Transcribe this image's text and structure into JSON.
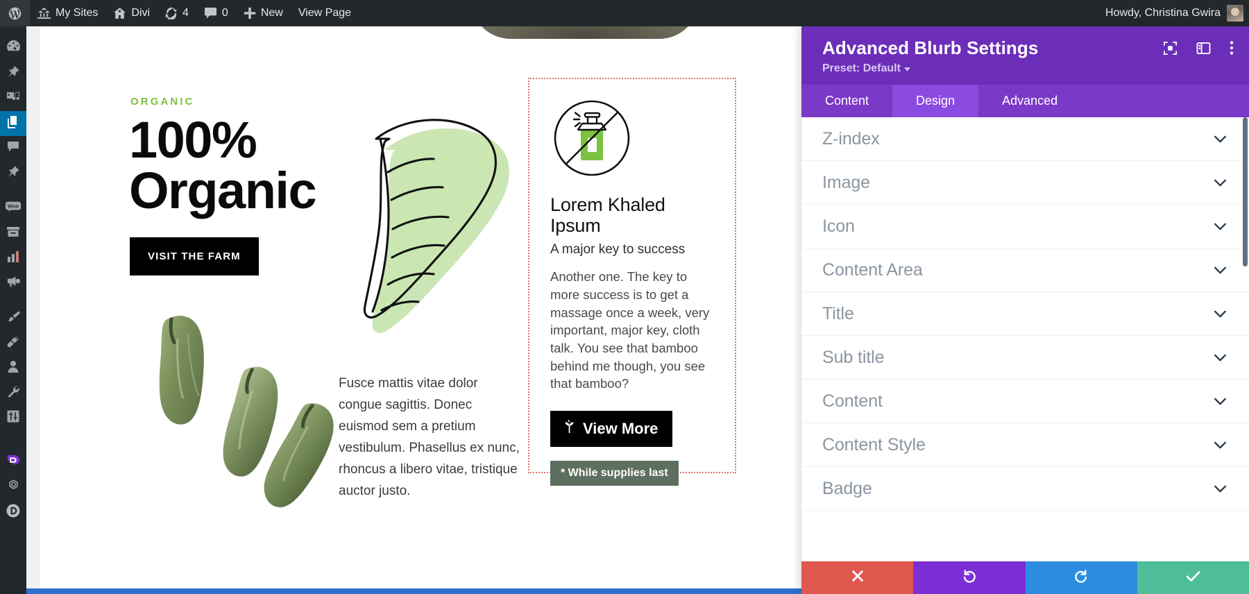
{
  "admin_bar": {
    "items": [
      {
        "id": "wp-logo",
        "icon": "wordpress-icon",
        "label": ""
      },
      {
        "id": "my-sites",
        "icon": "sites-icon",
        "label": "My Sites"
      },
      {
        "id": "site-name",
        "icon": "home-icon",
        "label": "Divi"
      },
      {
        "id": "updates",
        "icon": "updates-icon",
        "label": "4"
      },
      {
        "id": "comments",
        "icon": "comment-icon",
        "label": "0"
      },
      {
        "id": "new-content",
        "icon": "plus-icon",
        "label": "New"
      },
      {
        "id": "view-page",
        "icon": "",
        "label": "View Page"
      }
    ],
    "greeting": "Howdy, Christina Gwira"
  },
  "admin_menu": {
    "items": [
      {
        "name": "dashboard",
        "icon": "dashboard-icon",
        "active": false
      },
      {
        "name": "posts",
        "icon": "pin-icon",
        "active": false
      },
      {
        "name": "media",
        "icon": "media-icon",
        "active": false
      },
      {
        "name": "pages",
        "icon": "pages-icon",
        "active": true
      },
      {
        "name": "comments",
        "icon": "comment-icon",
        "active": false
      },
      {
        "name": "projects",
        "icon": "pin-icon",
        "active": false
      },
      {
        "name": "woocommerce",
        "icon": "woo-icon",
        "active": false
      },
      {
        "name": "products",
        "icon": "products-icon",
        "active": false
      },
      {
        "name": "analytics",
        "icon": "bar-chart-icon",
        "active": false
      },
      {
        "name": "marketing",
        "icon": "megaphone-icon",
        "active": false
      },
      {
        "name": "appearance",
        "icon": "paintbrush-icon",
        "active": false
      },
      {
        "name": "plugins",
        "icon": "plug-icon",
        "active": false
      },
      {
        "name": "users",
        "icon": "user-icon",
        "active": false
      },
      {
        "name": "tools",
        "icon": "wrench-icon",
        "active": false
      },
      {
        "name": "settings",
        "icon": "sliders-icon",
        "active": false
      },
      {
        "name": "divi-brand",
        "icon": "divi-badge-icon",
        "active": false
      },
      {
        "name": "bloom",
        "icon": "bloom-icon",
        "active": false
      },
      {
        "name": "divi-theme",
        "icon": "divi-circle-icon",
        "active": false
      }
    ]
  },
  "page": {
    "eyebrow": "ORGANIC",
    "heading_line1": "100%",
    "heading_line2": "Organic",
    "cta_label": "VISIT THE FARM",
    "paragraph": "Fusce mattis vitae dolor congue sagittis. Donec euismod sem a pretium vestibulum. Phasellus ex nunc, rhoncus a libero vitae, tristique auctor justo.",
    "eyebrow_color": "#7cc242",
    "leaf_color": "#a9d98b"
  },
  "blurb": {
    "icon": "no-pesticide-icon",
    "title": "Lorem Khaled Ipsum",
    "subtitle": "A major key to success",
    "body": "Another one. The key to more success is to get a massage once a week, very important, major key, cloth talk. You see that bamboo behind me though, you see that bamboo?",
    "button_label": "View More",
    "button_icon": "plant-icon",
    "badge_label": "* While supplies last",
    "badge_color": "#5d6f5f",
    "selection_outline_color": "#e36e6e"
  },
  "settings_panel": {
    "title": "Advanced Blurb Settings",
    "preset": "Preset: Default",
    "header_icons": [
      {
        "name": "focus-icon"
      },
      {
        "name": "panel-layout-icon"
      },
      {
        "name": "more-vertical-icon"
      }
    ],
    "tabs": [
      {
        "label": "Content",
        "active": false
      },
      {
        "label": "Design",
        "active": true
      },
      {
        "label": "Advanced",
        "active": false
      }
    ],
    "accordions": [
      {
        "label": "Z-index"
      },
      {
        "label": "Image"
      },
      {
        "label": "Icon"
      },
      {
        "label": "Content Area"
      },
      {
        "label": "Title"
      },
      {
        "label": "Sub title"
      },
      {
        "label": "Content"
      },
      {
        "label": "Content Style"
      },
      {
        "label": "Badge"
      }
    ],
    "actions": [
      {
        "name": "close",
        "icon": "close-icon",
        "color": "#e0584e"
      },
      {
        "name": "undo",
        "icon": "undo-icon",
        "color": "#7b2fd4"
      },
      {
        "name": "redo",
        "icon": "redo-icon",
        "color": "#2c8de0"
      },
      {
        "name": "save",
        "icon": "check-icon",
        "color": "#4dbd9a"
      }
    ],
    "accent_color": "#6c2eb9"
  }
}
